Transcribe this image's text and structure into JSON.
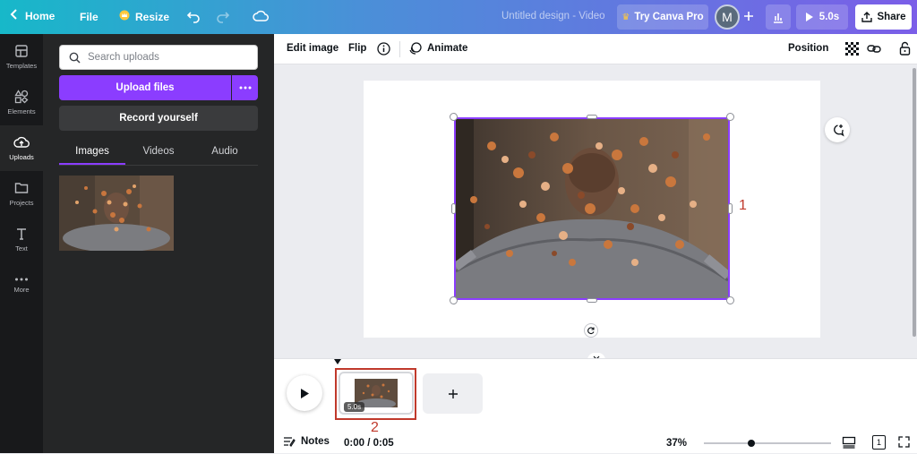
{
  "topbar": {
    "home_label": "Home",
    "file_label": "File",
    "resize_label": "Resize",
    "doc_title": "Untitled design - Video",
    "try_pro_label": "Try Canva Pro",
    "avatar_initial": "M",
    "duration_label": "5.0s",
    "share_label": "Share"
  },
  "sidebar": {
    "items": [
      {
        "label": "Templates",
        "icon": "templates-icon"
      },
      {
        "label": "Elements",
        "icon": "elements-icon"
      },
      {
        "label": "Uploads",
        "icon": "uploads-icon"
      },
      {
        "label": "Projects",
        "icon": "folder-icon"
      },
      {
        "label": "Text",
        "icon": "text-icon"
      },
      {
        "label": "More",
        "icon": "more-icon"
      }
    ],
    "active": "Uploads"
  },
  "panel": {
    "search_placeholder": "Search uploads",
    "upload_label": "Upload files",
    "record_label": "Record yourself",
    "tabs": [
      "Images",
      "Videos",
      "Audio"
    ],
    "active_tab": "Images"
  },
  "toolbar": {
    "edit_image": "Edit image",
    "flip": "Flip",
    "animate": "Animate",
    "position": "Position"
  },
  "annotations": {
    "one": "1",
    "two": "2"
  },
  "timeline": {
    "clip_duration": "5.0s",
    "notes_label": "Notes",
    "time_readout": "0:00 / 0:05",
    "zoom": "37%",
    "zoom_fraction": 0.37,
    "page_count": "1"
  },
  "colors": {
    "accent": "#8b3dff",
    "annotation": "#c0392b",
    "sidebar_bg": "#18191b",
    "panel_bg": "#252627"
  }
}
